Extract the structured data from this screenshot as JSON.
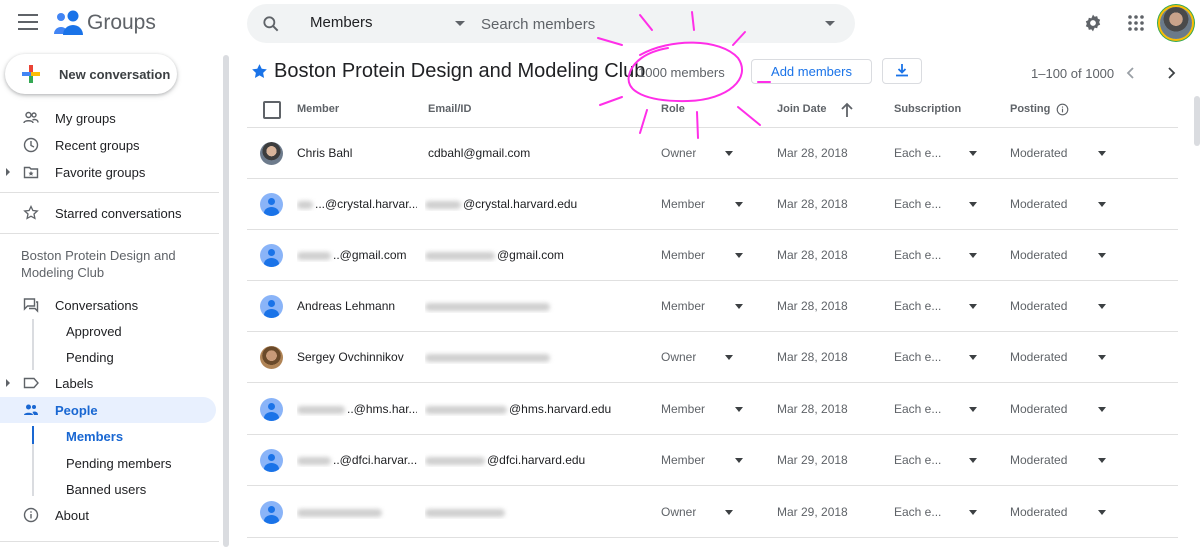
{
  "app": {
    "title": "Groups"
  },
  "search": {
    "scope": "Members",
    "placeholder": "Search members"
  },
  "sidebar": {
    "new_conversation": "New conversation",
    "top_items": [
      {
        "label": "My groups",
        "icon": "people-icon"
      },
      {
        "label": "Recent groups",
        "icon": "clock-icon"
      },
      {
        "label": "Favorite groups",
        "icon": "folder-star-icon"
      }
    ],
    "starred": "Starred conversations",
    "group_name": "Boston Protein Design and Modeling Club",
    "group_items": {
      "conversations": "Conversations",
      "approved": "Approved",
      "pending": "Pending",
      "labels": "Labels",
      "people": "People",
      "members": "Members",
      "pending_members": "Pending members",
      "banned_users": "Banned users",
      "about": "About"
    }
  },
  "header": {
    "group_title": "Boston Protein Design and Modeling Club",
    "member_count": "1000 members",
    "add_members": "Add members",
    "pagination": "1–100 of 1000"
  },
  "table": {
    "columns": [
      "Member",
      "Email/ID",
      "Role",
      "Join Date",
      "Subscription",
      "Posting"
    ],
    "rows": [
      {
        "member": "Chris Bahl",
        "email": "cdbahl@gmail.com",
        "role": "Owner",
        "join_date": "Mar 28, 2018",
        "subscription": "Each e...",
        "posting": "Moderated",
        "avatar": "photo"
      },
      {
        "member": "...@crystal.harvar...",
        "email": "@crystal.harvard.edu",
        "role": "Member",
        "join_date": "Mar 28, 2018",
        "subscription": "Each e...",
        "posting": "Moderated",
        "avatar": "default"
      },
      {
        "member": "..@gmail.com",
        "email": "@gmail.com",
        "role": "Member",
        "join_date": "Mar 28, 2018",
        "subscription": "Each e...",
        "posting": "Moderated",
        "avatar": "default"
      },
      {
        "member": "Andreas Lehmann",
        "email": "",
        "role": "Member",
        "join_date": "Mar 28, 2018",
        "subscription": "Each e...",
        "posting": "Moderated",
        "avatar": "default"
      },
      {
        "member": "Sergey Ovchinnikov",
        "email": "",
        "role": "Owner",
        "join_date": "Mar 28, 2018",
        "subscription": "Each e...",
        "posting": "Moderated",
        "avatar": "photo2"
      },
      {
        "member": "..@hms.har...",
        "email": "@hms.harvard.edu",
        "role": "Member",
        "join_date": "Mar 28, 2018",
        "subscription": "Each e...",
        "posting": "Moderated",
        "avatar": "default"
      },
      {
        "member": "..@dfci.harvar...",
        "email": "@dfci.harvard.edu",
        "role": "Member",
        "join_date": "Mar 29, 2018",
        "subscription": "Each e...",
        "posting": "Moderated",
        "avatar": "default"
      },
      {
        "member": "",
        "email": "",
        "role": "Owner",
        "join_date": "Mar 29, 2018",
        "subscription": "Each e...",
        "posting": "Moderated",
        "avatar": "default"
      }
    ]
  },
  "colors": {
    "accent": "#1a73e8",
    "active_bg": "#e8f0fe",
    "annotation": "#ff2ee8"
  }
}
